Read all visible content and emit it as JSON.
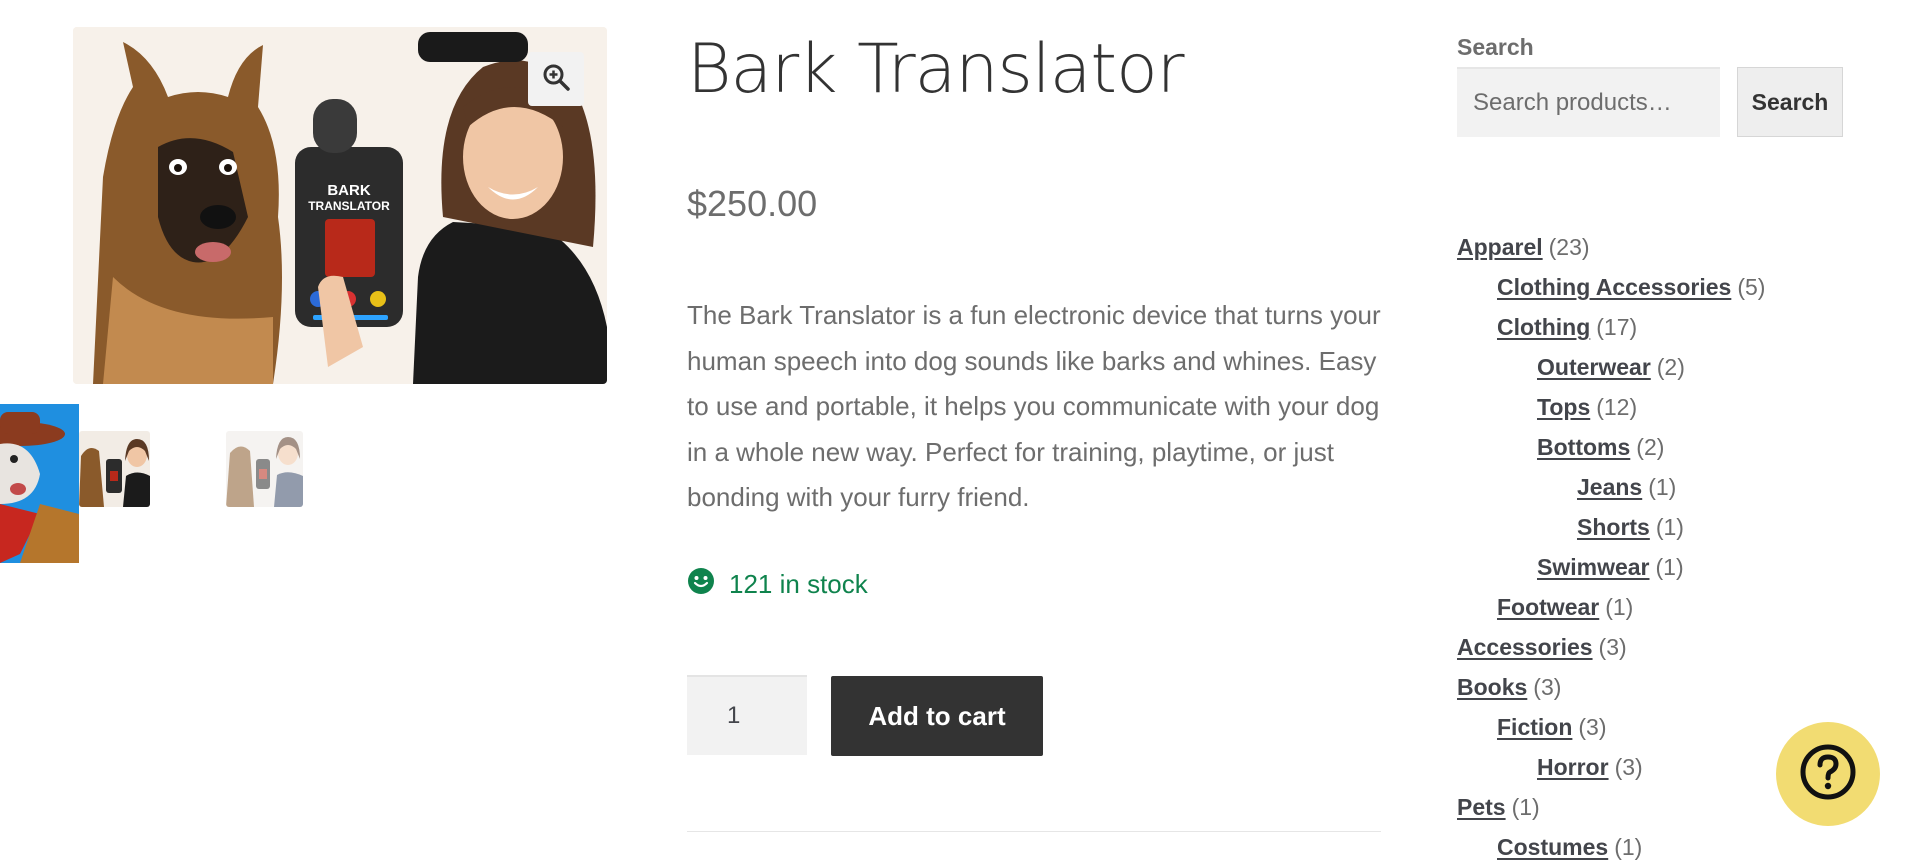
{
  "product": {
    "title": "Bark Translator",
    "price": "$250.00",
    "description": "The Bark Translator is a fun electronic device that turns your human speech into dog sounds like barks and whines. Easy to use and portable, it helps you communicate with your dog in a whole new way. Perfect for training, playtime, or just bonding with your furry friend.",
    "stock": "121 in stock",
    "quantity": "1",
    "add_to_cart_label": "Add to cart",
    "image_device_text": [
      "BARK",
      "TRANSLATOR"
    ]
  },
  "gallery": {
    "zoom_icon": "zoom-in-icon",
    "thumbnails": [
      "thumbnail-dog-costume",
      "thumbnail-bark-translator-1",
      "thumbnail-bark-translator-2"
    ]
  },
  "sidebar": {
    "search_title": "Search",
    "search_placeholder": "Search products…",
    "search_button": "Search",
    "categories": [
      {
        "label": "Apparel",
        "count": "(23)"
      },
      {
        "label": "Clothing Accessories",
        "count": "(5)"
      },
      {
        "label": "Clothing",
        "count": "(17)"
      },
      {
        "label": "Outerwear",
        "count": "(2)"
      },
      {
        "label": "Tops",
        "count": "(12)"
      },
      {
        "label": "Bottoms",
        "count": "(2)"
      },
      {
        "label": "Jeans",
        "count": "(1)"
      },
      {
        "label": "Shorts",
        "count": "(1)"
      },
      {
        "label": "Swimwear",
        "count": "(1)"
      },
      {
        "label": "Footwear",
        "count": "(1)"
      },
      {
        "label": "Accessories",
        "count": "(3)"
      },
      {
        "label": "Books",
        "count": "(3)"
      },
      {
        "label": "Fiction",
        "count": "(3)"
      },
      {
        "label": "Horror",
        "count": "(3)"
      },
      {
        "label": "Pets",
        "count": "(1)"
      },
      {
        "label": "Costumes",
        "count": "(1)"
      }
    ]
  },
  "help": {
    "icon": "question-mark-icon"
  },
  "colors": {
    "stock_green": "#0f834d",
    "button_dark": "#333333",
    "help_yellow": "#f2dc72"
  }
}
